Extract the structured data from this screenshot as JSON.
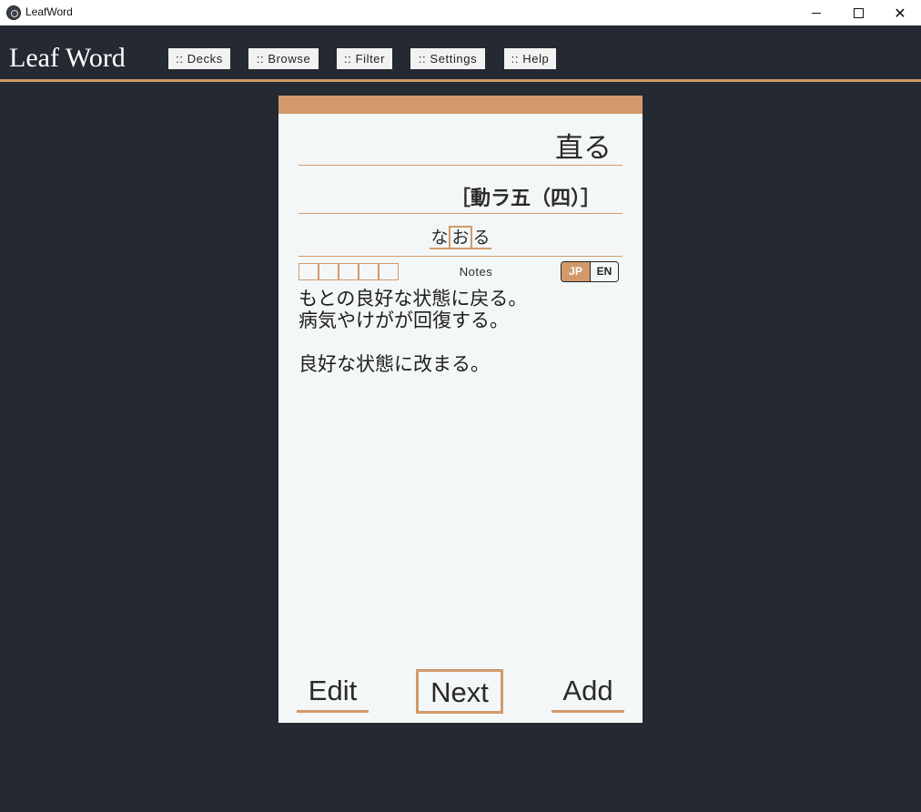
{
  "window": {
    "title": "LeafWord",
    "close_glyph": "✕"
  },
  "header": {
    "logo": "Leaf Word",
    "nav": {
      "decks": ":: Decks",
      "browse": ":: Browse",
      "filter": ":: Filter",
      "settings": ":: Settings",
      "help": ":: Help"
    }
  },
  "card": {
    "word": "直る",
    "part_of_speech": "［動ラ五（四）］",
    "reading": [
      "な",
      "お",
      "る"
    ],
    "notes_label": "Notes",
    "lang": {
      "jp": "JP",
      "en": "EN",
      "active": "JP"
    },
    "definition": {
      "line1": "もとの良好な状態に戻る。",
      "line2": "病気やけがが回復する。",
      "line3": "良好な状態に改まる。"
    },
    "actions": {
      "edit": "Edit",
      "next": "Next",
      "add": "Add"
    }
  },
  "colors": {
    "accent": "#d29a6a",
    "background": "#252931",
    "card": "#f4f7f8"
  },
  "icons": {
    "app": "leafword-app-icon",
    "minimize": "minimize-icon",
    "maximize": "maximize-icon",
    "close": "close-icon"
  }
}
